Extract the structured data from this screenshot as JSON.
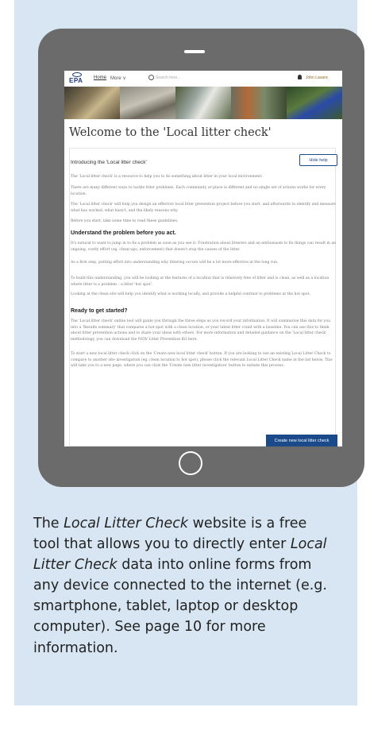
{
  "screen": {
    "logo_text": "EPA",
    "nav": {
      "home": "Home",
      "more": "More ∨"
    },
    "search_placeholder": "Search here...",
    "user_name": "John Lavanc",
    "page_title": "Welcome to the 'Local litter check'",
    "intro_heading": "Introducing the 'Local litter check'",
    "hide_help": "Hide help",
    "intro_paragraphs": [
      "The 'Local litter check' is a resource to help you to do something about litter in your local environment.",
      "There are many different ways to tackle litter problems. Each community or place is different and no single set of actions works for every location.",
      "The 'Local litter check' will help you design an effective local litter prevention project before you start, and afterwards to identify and measure what has worked, what hasn't, and the likely reasons why.",
      "Before you start, take some time to read these guidelines."
    ],
    "understand_heading": "Understand the problem before you act.",
    "understand_paragraphs": [
      "It's natural to want to jump in to fix a problem as soon as you see it. Frustration about litterers and an enthusiasm to fix things can result in an ongoing, costly effort (eg. clean-ups, enforcement) that doesn't stop the causes of the litter.",
      "As a first step, putting effort into understanding why littering occurs will be a lot more effective in the long run.",
      "To build this understanding, you will be looking at the features of a location that is relatively free of litter and is clean, as well as a location where litter is a problem – a litter 'hot spot'.",
      "Looking at the clean site will help you identify what is working locally, and provide a helpful contrast to problems at the hot spot."
    ],
    "ready_heading": "Ready to get started?",
    "ready_paragraphs": [
      "The 'Local litter check' online tool will guide you through the three steps as you record your information. It will summarise this data for you into a 'Results summary' that compares a hot spot with a clean location, or your latest litter count with a baseline. You can use this to think about litter prevention actions and to share your ideas with others. For more information and detailed guidance on the 'Local litter check' methodology, you can download the NSW Litter Prevention Kit here.",
      "To start a new local litter check click on the 'Create new local litter check' button. If you are looking to use an existing Local Litter Check to compare to another site investigation (eg. clean location to hot spot), please click the relevant Local Litter Check name in the list below. This will take you to a new page, where you can click the 'Create new litter investigation' button to initiate this process."
    ],
    "create_button": "Create new local litter check"
  },
  "caption": {
    "part1": "The ",
    "italic1": "Local Litter Check",
    "part2": " website is a free tool that allows you to directly enter ",
    "italic2": "Local Litter Check",
    "part3": " data into online forms from any device connected to the internet (e.g. smartphone, tablet, laptop or desktop computer). See page 10 for more information."
  },
  "colors": {
    "panel_bg": "#d7e6f2",
    "tablet_frame": "#6b6b6b",
    "brand_blue": "#1a4a8a"
  },
  "icons": [
    "search-icon",
    "bell-icon",
    "home-button-icon"
  ]
}
